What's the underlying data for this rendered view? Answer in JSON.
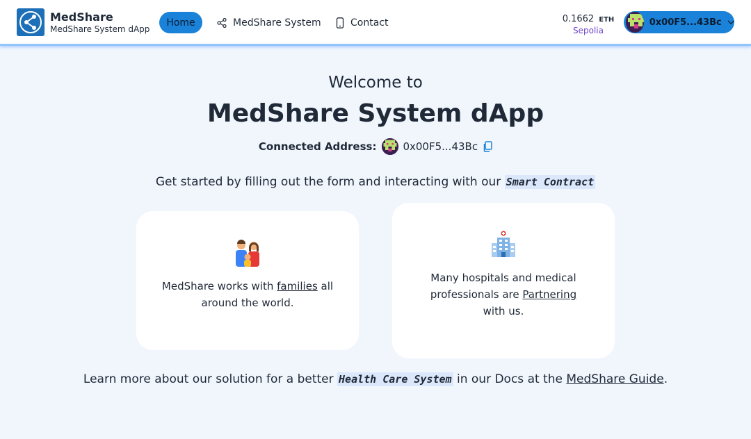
{
  "brand": {
    "title": "MedShare",
    "subtitle": "MedShare System dApp"
  },
  "nav": {
    "home": "Home",
    "system": "MedShare System",
    "contact": "Contact"
  },
  "wallet": {
    "balance": "0.1662",
    "unit": "ETH",
    "network": "Sepolia",
    "address": "0x00F5...43Bc"
  },
  "main": {
    "welcome": "Welcome to",
    "title": "MedShare System dApp",
    "connected_label": "Connected Address:",
    "connected_address": "0x00F5...43Bc",
    "intro_prefix": "Get started by filling out the form and interacting with our",
    "intro_code": "Smart Contract"
  },
  "cards": [
    {
      "icon": "family-icon",
      "pre": "MedShare works with ",
      "link": "families",
      "post": " all around the world."
    },
    {
      "icon": "hospital-icon",
      "pre": "Many hospitals and medical professionals are ",
      "link": "Partnering",
      "post": " with us."
    }
  ],
  "footer": {
    "prefix": "Learn more about our solution for a better",
    "code": "Health Care System",
    "mid": "in our Docs at the",
    "link": "MedShare Guide",
    "suffix": "."
  },
  "colors": {
    "accent": "#1a82d8",
    "network": "#6d43c9",
    "background": "#f1f6fd"
  }
}
